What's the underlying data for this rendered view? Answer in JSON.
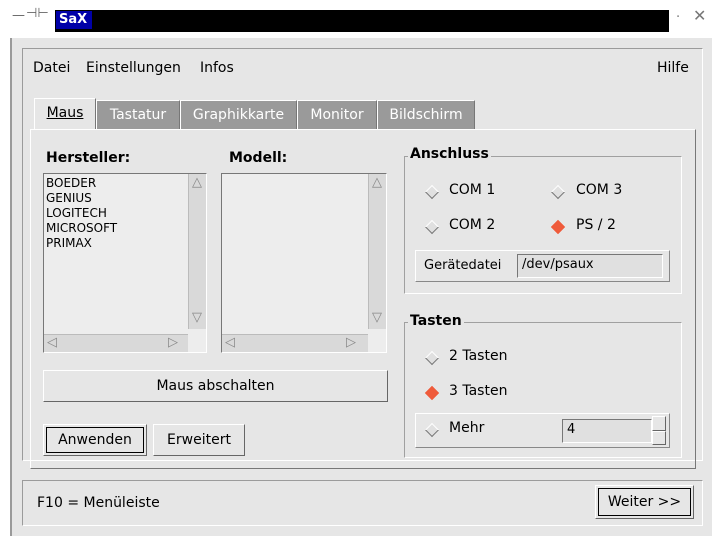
{
  "titlebar": {
    "title": "SaX"
  },
  "menubar": {
    "items": [
      "Datei",
      "Einstellungen",
      "Infos"
    ],
    "help": "Hilfe"
  },
  "tabs": [
    {
      "label": "Maus",
      "active": true
    },
    {
      "label": "Tastatur",
      "active": false
    },
    {
      "label": "Graphikkarte",
      "active": false
    },
    {
      "label": "Monitor",
      "active": false
    },
    {
      "label": "Bildschirm",
      "active": false
    }
  ],
  "mouse": {
    "vendor_label": "Hersteller:",
    "model_label": "Modell:",
    "vendors": [
      "BOEDER",
      "GENIUS",
      "LOGITECH",
      "MICROSOFT",
      "PRIMAX"
    ],
    "models": [],
    "disable_button": "Maus abschalten",
    "apply_button": "Anwenden",
    "advanced_button": "Erweitert"
  },
  "connection": {
    "title": "Anschluss",
    "options": [
      {
        "label": "COM 1",
        "selected": false
      },
      {
        "label": "COM 3",
        "selected": false
      },
      {
        "label": "COM 2",
        "selected": false
      },
      {
        "label": "PS / 2",
        "selected": true
      }
    ],
    "device_label": "Gerätedatei",
    "device_value": "/dev/psaux"
  },
  "buttons": {
    "title": "Tasten",
    "options": [
      {
        "label": "2 Tasten",
        "selected": false
      },
      {
        "label": "3 Tasten",
        "selected": true
      },
      {
        "label": "Mehr",
        "selected": false
      }
    ],
    "more_value": "4"
  },
  "status": {
    "hint": "F10 = Menüleiste",
    "next_button": "Weiter >>"
  },
  "colors": {
    "background": "#e6e6e6",
    "title_bar": "#0000a8",
    "radio_selected": "#ef5b3b",
    "inactive_tab": "#9a9a9a"
  }
}
